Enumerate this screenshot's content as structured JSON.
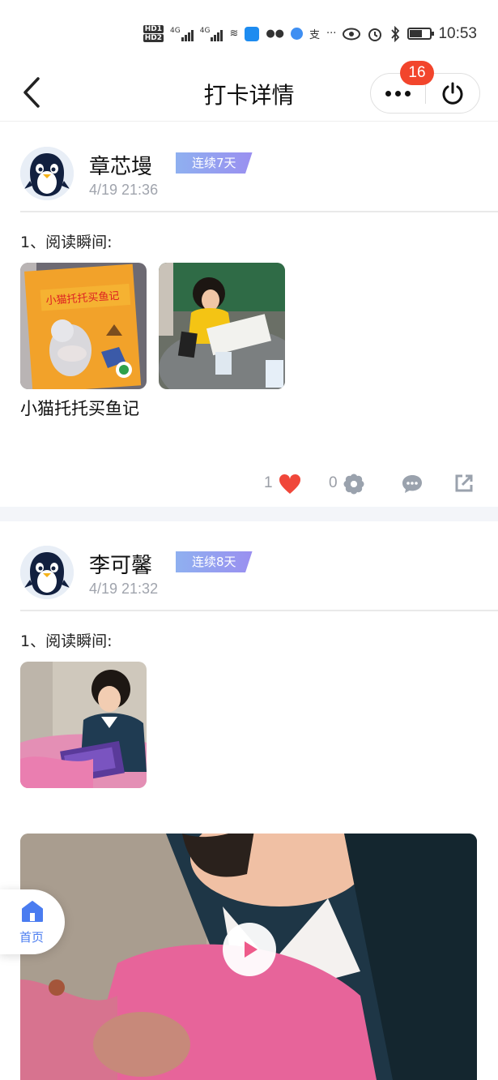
{
  "status_bar": {
    "hd1": "HD",
    "hd1_sub": "1",
    "hd2": "HD",
    "hd2_sub": "2",
    "net1": "4G",
    "net2": "4G",
    "more": "···",
    "time": "10:53",
    "icons": [
      "hd-icon",
      "signal-icon",
      "signal-icon",
      "wifi-calling-icon",
      "app-icon",
      "wechat-icon",
      "app-icon",
      "alipay-icon",
      "more-icon",
      "eye-icon",
      "alarm-icon",
      "bluetooth-icon",
      "battery-icon"
    ]
  },
  "header": {
    "title": "打卡详情",
    "badge_count": "16"
  },
  "posts": [
    {
      "username": "章芯墁",
      "streak": "连续7天",
      "time": "4/19 21:36",
      "section": "1、阅读瞬间:",
      "caption": "小猫托托买鱼记",
      "book_title": "小猫托托买鱼记",
      "likes": "1",
      "flowers": "0"
    },
    {
      "username": "李可馨",
      "streak": "连续8天",
      "time": "4/19 21:32",
      "section": "1、阅读瞬间:"
    }
  ],
  "home": {
    "label": "首页"
  },
  "colors": {
    "accent_blue": "#4a7cf0",
    "like_red": "#f0473a",
    "badge_red": "#f2452c",
    "muted": "#9a9ea6"
  }
}
